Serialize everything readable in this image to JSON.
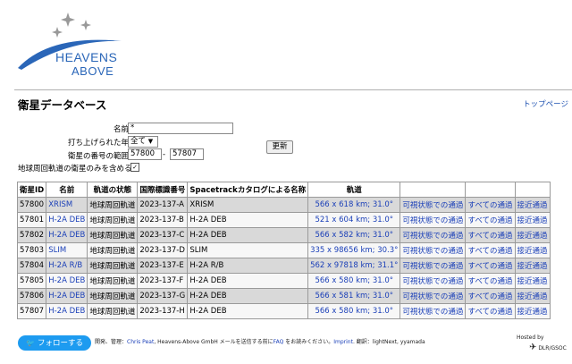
{
  "header": {
    "logo_line1": "HEAVENS",
    "logo_line2": "ABOVE",
    "page_title": "衛星データベース",
    "top_page_link": "トップページ"
  },
  "form": {
    "name_label": "名前",
    "name_value": "*",
    "year_label": "打ち上げられた年",
    "year_value": "全て",
    "number_range_label": "衛星の番号の範囲",
    "range_from": "57800",
    "range_sep": "-",
    "range_to": "57807",
    "update_button": "更新",
    "earth_orbit_only_label": "地球周回軌道の衛星のみを含める",
    "earth_orbit_only_checked": true
  },
  "table": {
    "headers": [
      "衛星ID",
      "名前",
      "軌道の状態",
      "国際標識番号",
      "Spacetrackカタログによる名称",
      "軌道",
      "",
      "",
      ""
    ],
    "rows": [
      {
        "id": "57800",
        "name": "XRISM",
        "status": "地球周回軌道",
        "intl": "2023-137-A",
        "catalog": "XRISM",
        "orbit": "566 x 618 km; 31.0°",
        "visible": "可視状態での通過",
        "all": "すべての通過",
        "close": "接近通過"
      },
      {
        "id": "57801",
        "name": "H-2A DEB",
        "status": "地球周回軌道",
        "intl": "2023-137-B",
        "catalog": "H-2A DEB",
        "orbit": "521 x 604 km; 31.0°",
        "visible": "可視状態での通過",
        "all": "すべての通過",
        "close": "接近通過"
      },
      {
        "id": "57802",
        "name": "H-2A DEB",
        "status": "地球周回軌道",
        "intl": "2023-137-C",
        "catalog": "H-2A DEB",
        "orbit": "566 x 582 km; 31.0°",
        "visible": "可視状態での通過",
        "all": "すべての通過",
        "close": "接近通過"
      },
      {
        "id": "57803",
        "name": "SLIM",
        "status": "地球周回軌道",
        "intl": "2023-137-D",
        "catalog": "SLIM",
        "orbit": "335 x 98656 km; 30.3°",
        "visible": "可視状態での通過",
        "all": "すべての通過",
        "close": "接近通過"
      },
      {
        "id": "57804",
        "name": "H-2A R/B",
        "status": "地球周回軌道",
        "intl": "2023-137-E",
        "catalog": "H-2A R/B",
        "orbit": "562 x 97818 km; 31.1°",
        "visible": "可視状態での通過",
        "all": "すべての通過",
        "close": "接近通過"
      },
      {
        "id": "57805",
        "name": "H-2A DEB",
        "status": "地球周回軌道",
        "intl": "2023-137-F",
        "catalog": "H-2A DEB",
        "orbit": "566 x 580 km; 31.0°",
        "visible": "可視状態での通過",
        "all": "すべての通過",
        "close": "接近通過"
      },
      {
        "id": "57806",
        "name": "H-2A DEB",
        "status": "地球周回軌道",
        "intl": "2023-137-G",
        "catalog": "H-2A DEB",
        "orbit": "566 x 581 km; 31.0°",
        "visible": "可視状態での通過",
        "all": "すべての通過",
        "close": "接近通過"
      },
      {
        "id": "57807",
        "name": "H-2A DEB",
        "status": "地球周回軌道",
        "intl": "2023-137-H",
        "catalog": "H-2A DEB",
        "orbit": "566 x 580 km; 31.0°",
        "visible": "可視状態での通過",
        "all": "すべての通過",
        "close": "接近通過"
      }
    ]
  },
  "footer": {
    "follow_button": "フォローする",
    "text_1": "開発、管理：",
    "author_link": "Chris Peat",
    "text_2": ", Heavens-Above GmbH メールを送信する前に",
    "faq_link": "FAQ",
    "text_3": " をお読みください。",
    "imprint_link": "Imprint",
    "text_4": ". 翻訳：lightNext, yyamada",
    "hosted_by": "Hosted by",
    "dlr": "DLR/GSOC"
  },
  "colors": {
    "accent": "#1a3fb8",
    "twitter": "#1d9bf0",
    "row_odd": "#d9d9d9"
  }
}
